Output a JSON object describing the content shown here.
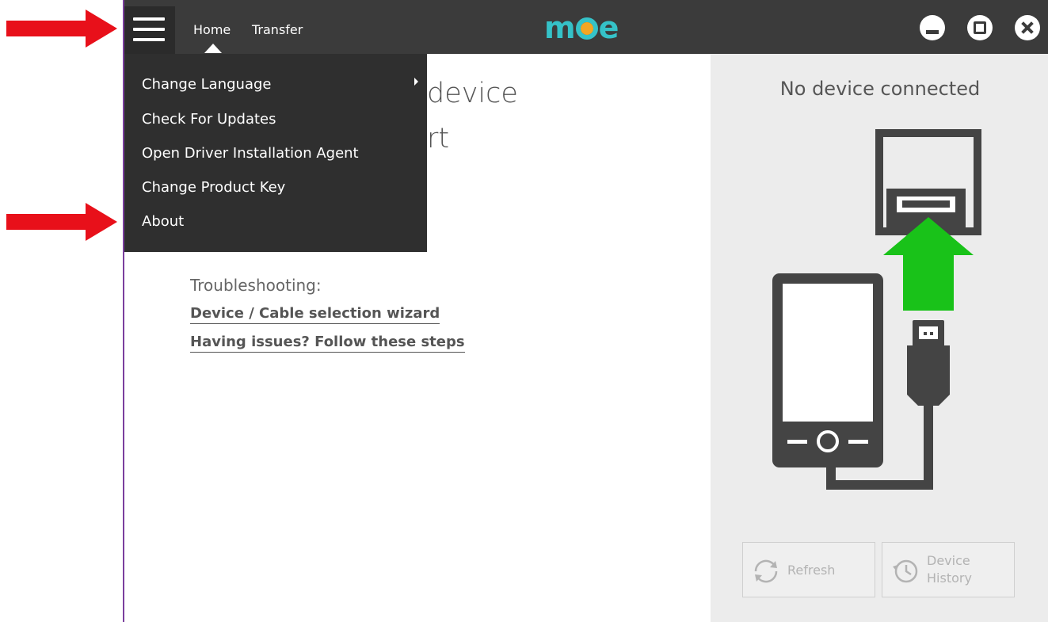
{
  "nav": {
    "home": "Home",
    "transfer": "Transfer"
  },
  "logo": {
    "text_left": "m",
    "text_right": "e",
    "dot_color": "#f5a623",
    "brand_color": "#35c2c8"
  },
  "window_controls": {
    "minimize": "minimize-icon",
    "maximize": "maximize-icon",
    "close": "close-icon"
  },
  "menu": {
    "items": [
      {
        "label": "Change Language",
        "has_submenu": true
      },
      {
        "label": "Check For Updates"
      },
      {
        "label": "Open Driver Installation Agent"
      },
      {
        "label": "Change Product Key"
      },
      {
        "label": "About"
      }
    ]
  },
  "main": {
    "headline_line1_visible": "device",
    "headline_line2_visible": "rt",
    "troubleshooting_title": "Troubleshooting:",
    "links": [
      "Device / Cable selection wizard",
      "Having issues? Follow these steps"
    ]
  },
  "right_panel": {
    "status": "No device connected",
    "refresh_label": "Refresh",
    "history_label_line1": "Device",
    "history_label_line2": "History",
    "arrow_color": "#19c219"
  },
  "annotation_arrows": {
    "color": "#e8101a"
  }
}
